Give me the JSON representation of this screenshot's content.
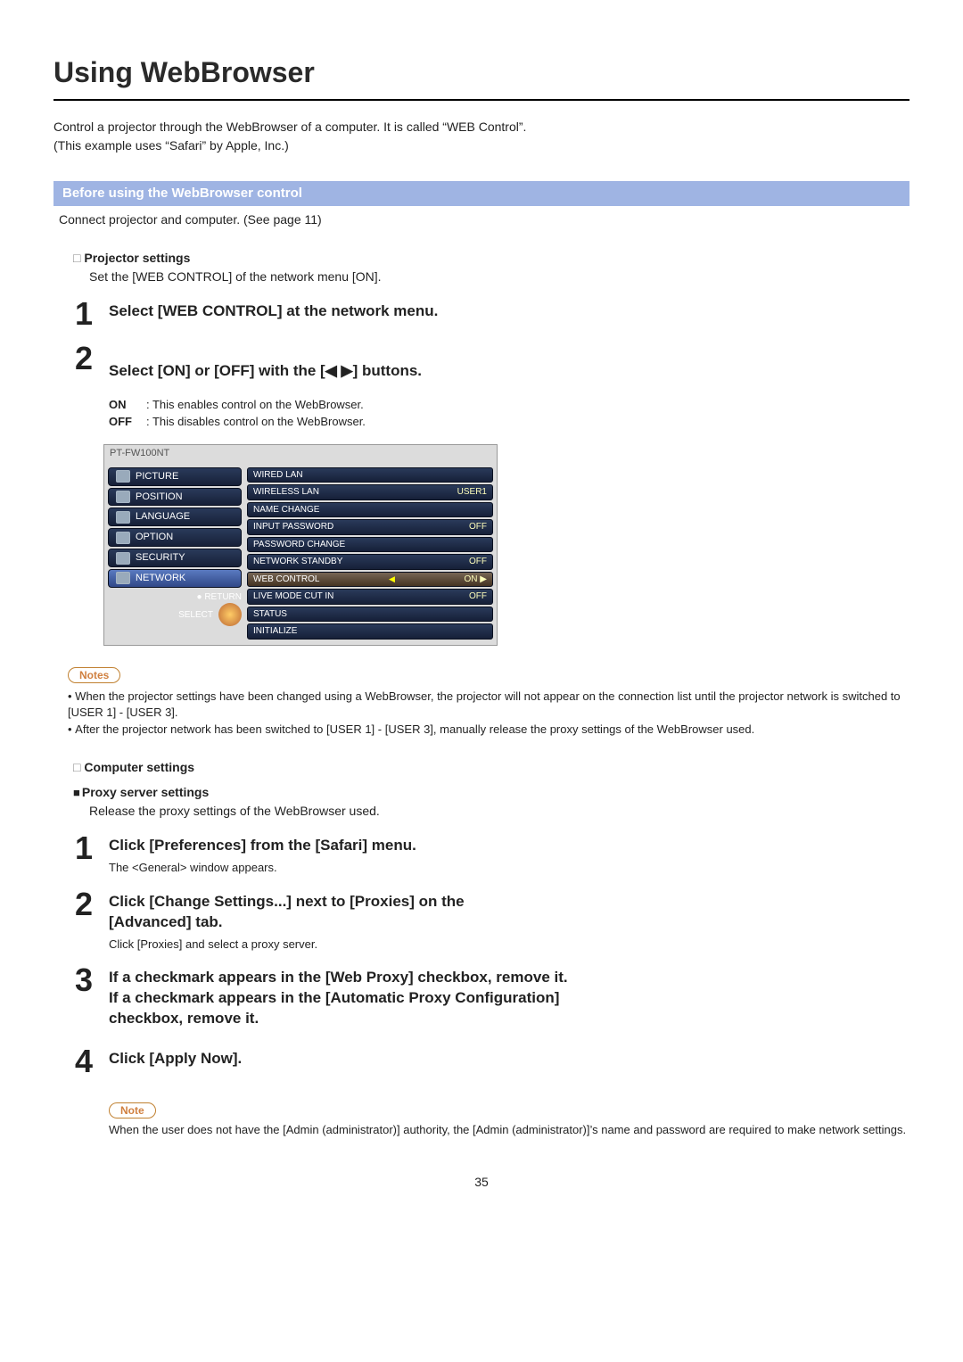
{
  "title": "Using WebBrowser",
  "intro_line1": "Control a projector through the WebBrowser of a computer. It is called “WEB Control”.",
  "intro_line2": "(This example uses “Safari” by Apple, Inc.)",
  "section_bar": "Before using the WebBrowser control",
  "connect_text": "Connect projector and computer. (See page 11)",
  "projector_settings_heading": "Projector settings",
  "projector_settings_text": "Set the [WEB CONTROL] of the network menu [ON].",
  "projector_steps": [
    {
      "num": "1",
      "title": "Select [WEB CONTROL] at the network menu."
    },
    {
      "num": "2",
      "title_prefix": "Select [ON] or [OFF] with the [",
      "title_suffix": "] buttons.",
      "on_label": "ON",
      "on_text": ": This enables control on the WebBrowser.",
      "off_label": "OFF",
      "off_text": ": This disables control on the WebBrowser."
    }
  ],
  "osd": {
    "model": "PT-FW100NT",
    "left_menu": [
      "PICTURE",
      "POSITION",
      "LANGUAGE",
      "OPTION",
      "SECURITY",
      "NETWORK"
    ],
    "return_label": "RETURN",
    "select_label": "SELECT",
    "right_rows": [
      {
        "label": "WIRED LAN",
        "val": ""
      },
      {
        "label": "WIRELESS LAN",
        "val": "USER1"
      },
      {
        "label": "NAME CHANGE",
        "val": ""
      },
      {
        "label": "INPUT PASSWORD",
        "val": "OFF"
      },
      {
        "label": "PASSWORD CHANGE",
        "val": ""
      },
      {
        "label": "NETWORK STANDBY",
        "val": "OFF"
      },
      {
        "label": "WEB CONTROL",
        "val": "ON",
        "hl": true,
        "arrows": true
      },
      {
        "label": "LIVE MODE CUT IN",
        "val": "OFF"
      },
      {
        "label": "STATUS",
        "val": ""
      },
      {
        "label": "INITIALIZE",
        "val": ""
      }
    ]
  },
  "notes_label": "Notes",
  "notes": [
    "When the projector settings have been changed using a WebBrowser, the projector will not appear on the connection list until the projector network is switched to [USER 1] - [USER 3].",
    "After the projector network has been switched to [USER 1] - [USER 3], manually release the proxy settings of the WebBrowser used."
  ],
  "computer_settings_heading": "Computer settings",
  "proxy_heading": "Proxy server settings",
  "proxy_text": "Release the proxy settings of the WebBrowser used.",
  "computer_steps": [
    {
      "num": "1",
      "title": "Click [Preferences] from the [Safari] menu.",
      "desc": "The <General> window appears."
    },
    {
      "num": "2",
      "title": "Click [Change Settings...] next to [Proxies] on the [Advanced] tab.",
      "desc": "Click [Proxies] and select a proxy server."
    },
    {
      "num": "3",
      "title": "If a checkmark appears in the [Web Proxy] checkbox, remove it. If a checkmark appears in the [Automatic Proxy Configuration] checkbox, remove it."
    },
    {
      "num": "4",
      "title": "Click [Apply Now]."
    }
  ],
  "note_label": "Note",
  "note_text": "When the user does not have the [Admin (administrator)] authority, the [Admin (administrator)]’s name and password are required to make network settings.",
  "page_number": "35"
}
